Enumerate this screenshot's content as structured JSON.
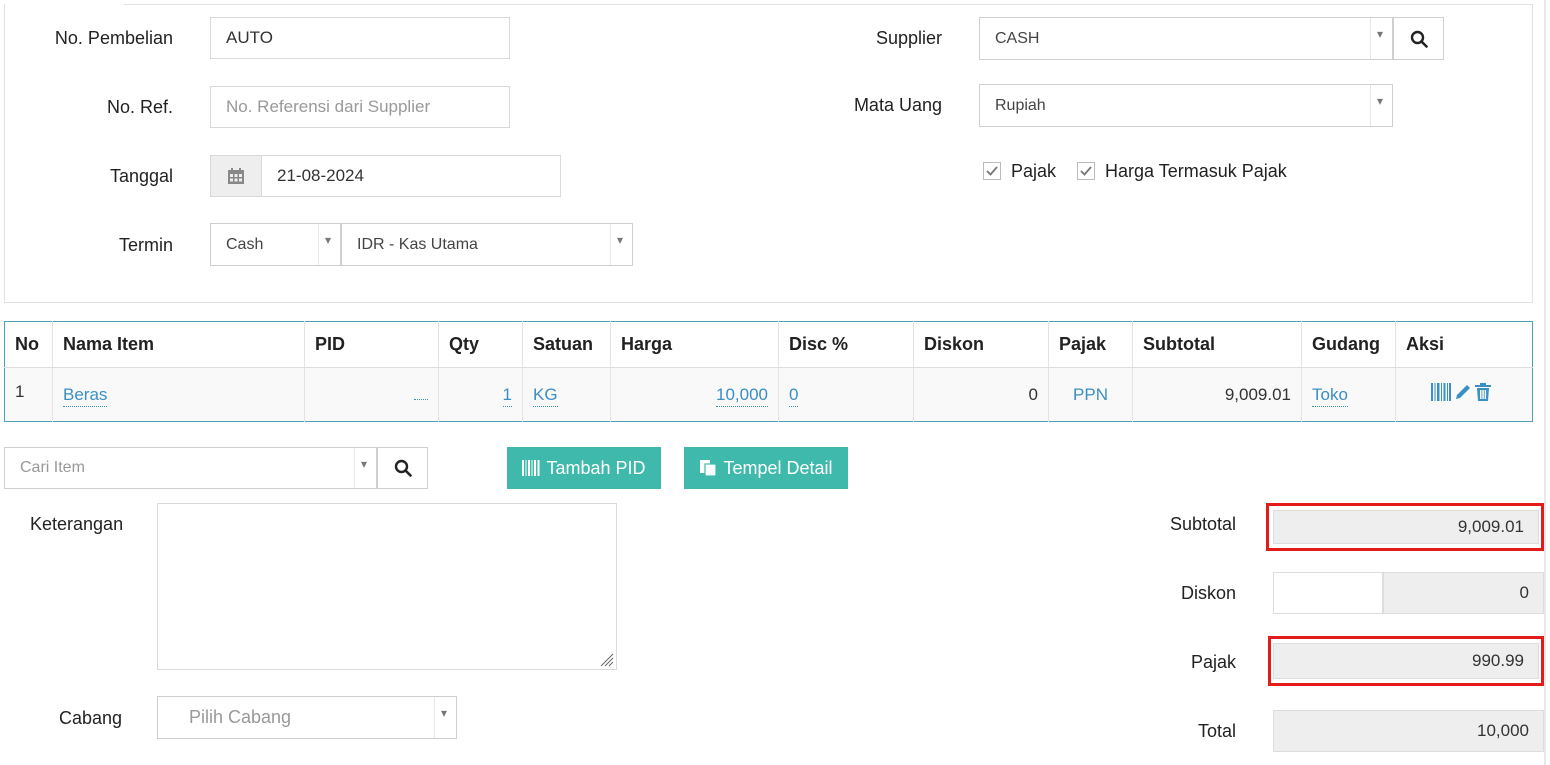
{
  "form": {
    "no_pembelian_label": "No. Pembelian",
    "no_pembelian_value": "AUTO",
    "no_ref_label": "No. Ref.",
    "no_ref_placeholder": "No. Referensi dari Supplier",
    "tanggal_label": "Tanggal",
    "tanggal_value": "21-08-2024",
    "termin_label": "Termin",
    "termin_value": "Cash",
    "kas_value": "IDR - Kas Utama",
    "supplier_label": "Supplier",
    "supplier_value": "CASH",
    "mata_uang_label": "Mata Uang",
    "mata_uang_value": "Rupiah",
    "pajak_checkbox_label": "Pajak",
    "pajak_checked": true,
    "harga_termasuk_pajak_label": "Harga Termasuk Pajak",
    "harga_termasuk_pajak_checked": true
  },
  "table": {
    "headers": [
      "No",
      "Nama Item",
      "PID",
      "Qty",
      "Satuan",
      "Harga",
      "Disc %",
      "Diskon",
      "Pajak",
      "Subtotal",
      "Gudang",
      "Aksi"
    ],
    "rows": [
      {
        "no": "1",
        "nama_item": "Beras",
        "pid": "",
        "qty": "1",
        "satuan": "KG",
        "harga": "10,000",
        "disc_pct": "0",
        "diskon": "0",
        "pajak": "PPN",
        "subtotal": "9,009.01",
        "gudang": "Toko"
      }
    ]
  },
  "actions": {
    "cari_item_placeholder": "Cari Item",
    "tambah_pid_label": "Tambah PID",
    "tempel_detail_label": "Tempel Detail"
  },
  "notes": {
    "keterangan_label": "Keterangan",
    "keterangan_value": "",
    "cabang_label": "Cabang",
    "cabang_placeholder": "Pilih Cabang"
  },
  "summary": {
    "subtotal_label": "Subtotal",
    "subtotal_value": "9,009.01",
    "diskon_label": "Diskon",
    "diskon_input": "",
    "diskon_value": "0",
    "pajak_label": "Pajak",
    "pajak_value": "990.99",
    "total_label": "Total",
    "total_value": "10,000"
  },
  "colors": {
    "accent_teal": "#3fb9ac",
    "link_blue": "#3a8fc5",
    "highlight_red": "#e31b1b",
    "table_border": "#4aa3b5"
  }
}
